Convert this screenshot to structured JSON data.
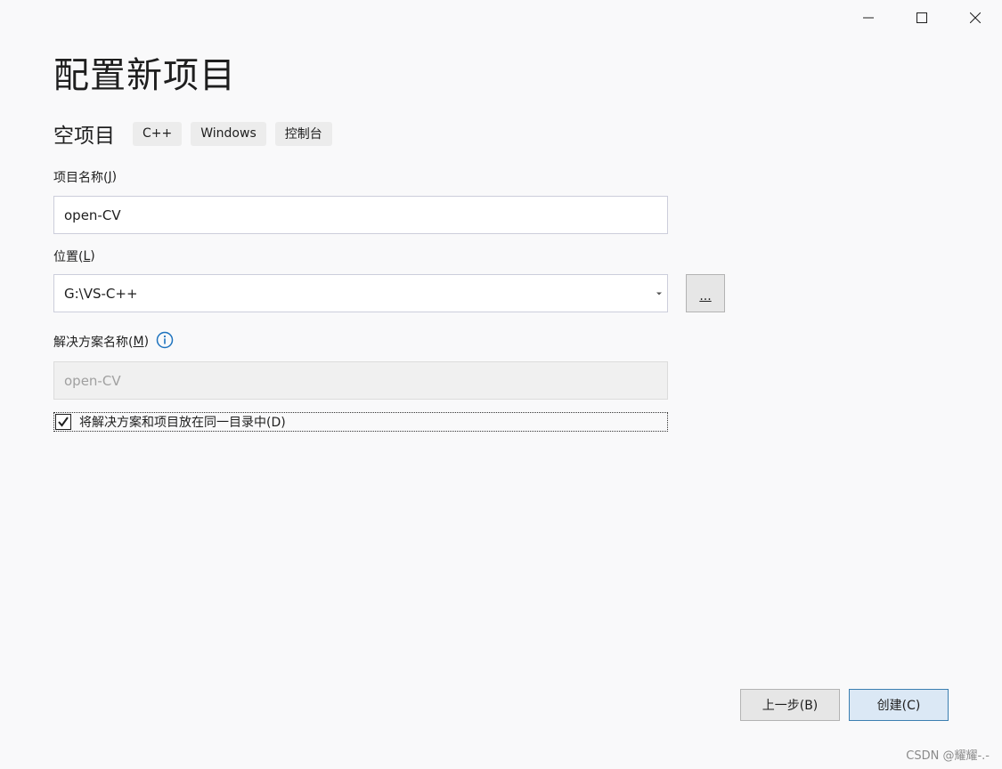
{
  "window": {
    "controls": [
      {
        "icon": "minimize-icon"
      },
      {
        "icon": "maximize-icon"
      },
      {
        "icon": "close-icon"
      }
    ]
  },
  "page": {
    "title": "配置新项目",
    "template_name": "空项目",
    "tags": [
      "C++",
      "Windows",
      "控制台"
    ]
  },
  "project_name": {
    "label": "项目名称(",
    "mnemonic": "J",
    "label_end": ")",
    "value": "open-CV"
  },
  "location": {
    "label": "位置(",
    "mnemonic": "L",
    "label_end": ")",
    "value": "G:\\VS-C++",
    "browse_label": "..."
  },
  "solution_name": {
    "label": "解决方案名称(",
    "mnemonic": "M",
    "label_end": ")",
    "info_icon": "info-icon",
    "value": "open-CV"
  },
  "same_dir": {
    "checked": true,
    "label": "将解决方案和项目放在同一目录中(D)"
  },
  "footer": {
    "back_label": "上一步(B)",
    "create_label": "创建(C)"
  },
  "watermark": "CSDN @耀耀-.-",
  "colors": {
    "background": "#f9f9fa",
    "primary_button_border": "#3c7fb1",
    "info_icon": "#1e73be"
  }
}
